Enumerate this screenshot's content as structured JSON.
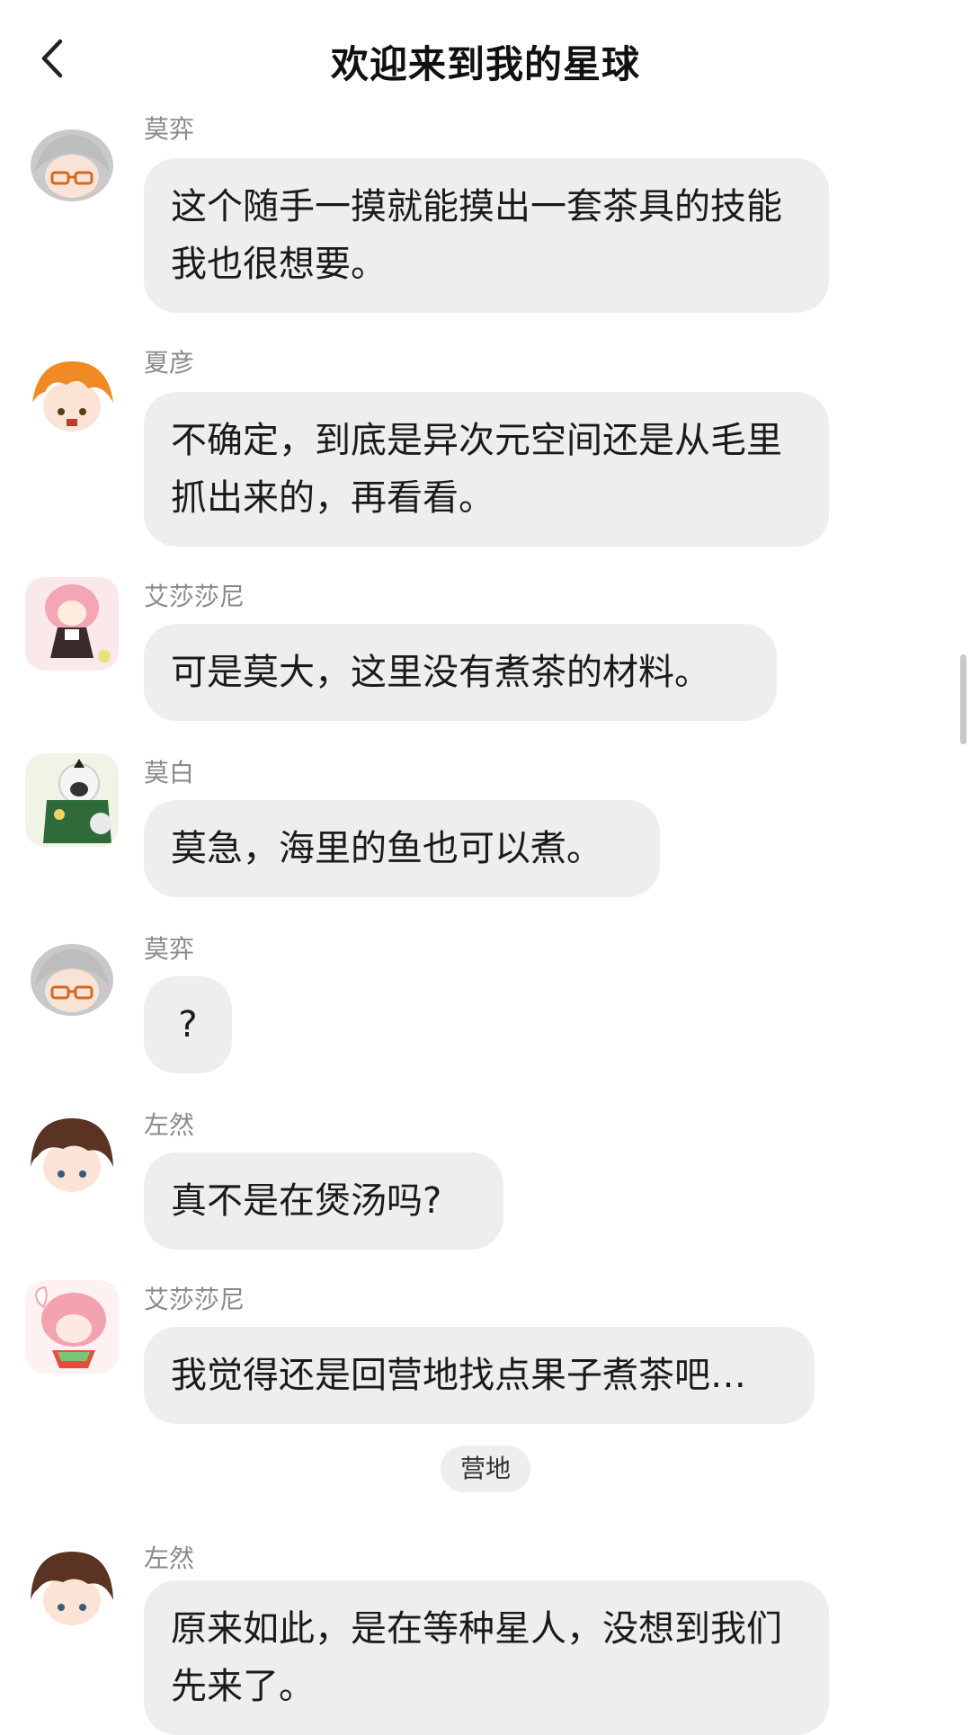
{
  "header": {
    "title": "欢迎来到我的星球",
    "back_icon": "chevron-left-icon"
  },
  "messages": [
    {
      "sender": "莫弈",
      "text": "这个随手一摸就能摸出一套茶具的技能我也很想要。",
      "avatar": "gray-hair-glasses-avatar"
    },
    {
      "sender": "夏彦",
      "text": "不确定，到底是异次元空间还是从毛里抓出来的，再看看。",
      "avatar": "orange-hair-avatar"
    },
    {
      "sender": "艾莎莎尼",
      "text": "可是莫大，这里没有煮茶的材料。",
      "avatar": "pink-hair-girl-avatar"
    },
    {
      "sender": "莫白",
      "text": "莫急，海里的鱼也可以煮。",
      "avatar": "white-sheep-avatar"
    },
    {
      "sender": "莫弈",
      "text": "?",
      "avatar": "gray-hair-glasses-avatar"
    },
    {
      "sender": "左然",
      "text": "真不是在煲汤吗?",
      "avatar": "brown-hair-avatar"
    },
    {
      "sender": "艾莎莎尼",
      "text": "我觉得还是回营地找点果子煮茶吧…",
      "avatar": "pink-animal-avatar"
    },
    {
      "sender": "左然",
      "text": "原来如此，是在等种星人，没想到我们先来了。",
      "avatar": "brown-hair-avatar"
    }
  ],
  "divider": {
    "label": "营地"
  },
  "colors": {
    "bubble": "#eeeeee",
    "sender_name": "#8a8a8a",
    "text": "#1a1a1a"
  }
}
